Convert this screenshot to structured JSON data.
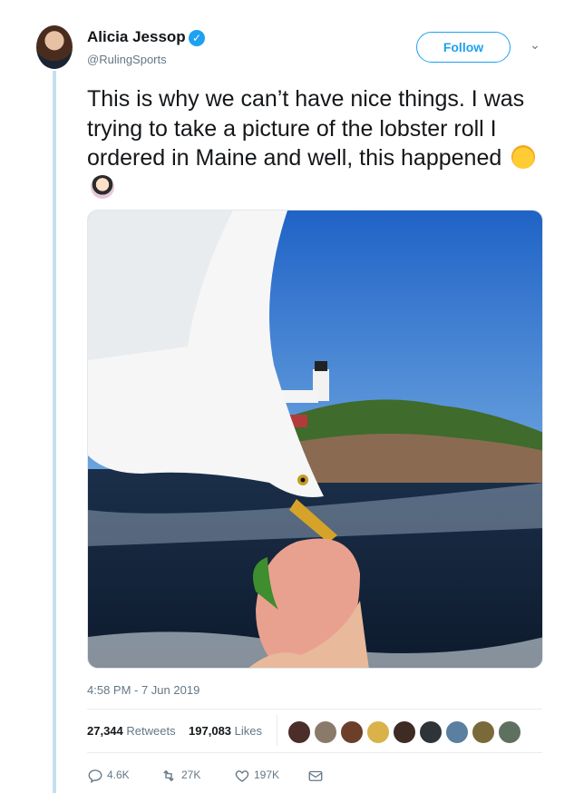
{
  "author": {
    "name": "Alicia Jessop",
    "handle": "@RulingSports",
    "verified_icon": "verified-badge-icon"
  },
  "header": {
    "follow_label": "Follow",
    "more_icon": "chevron-down-icon"
  },
  "tweet": {
    "text": "This is why we can’t have nice things. I was trying to take a picture of the lobster roll I ordered in Maine and well, this happened",
    "emojis": [
      "face-with-tears-of-joy-emoji",
      "woman-facepalming-emoji"
    ],
    "media_alt_icon": "photo-icon"
  },
  "meta": {
    "timestamp": "4:58 PM - 7 Jun 2019",
    "retweets_count": "27,344",
    "retweets_label": "Retweets",
    "likes_count": "197,083",
    "likes_label": "Likes"
  },
  "likers": [
    {
      "color": "#4b2e2a"
    },
    {
      "color": "#8a7a6a"
    },
    {
      "color": "#6b3f2a"
    },
    {
      "color": "#d9b24a"
    },
    {
      "color": "#3d2b24"
    },
    {
      "color": "#2f3438"
    },
    {
      "color": "#5a7fa0"
    },
    {
      "color": "#7a6a3a"
    },
    {
      "color": "#5e7060"
    }
  ],
  "actions": {
    "reply_count": "4.6K",
    "retweet_count": "27K",
    "like_count": "197K"
  },
  "colors": {
    "accent": "#1da1f2",
    "muted": "#657786",
    "thread": "#c4dff0"
  }
}
